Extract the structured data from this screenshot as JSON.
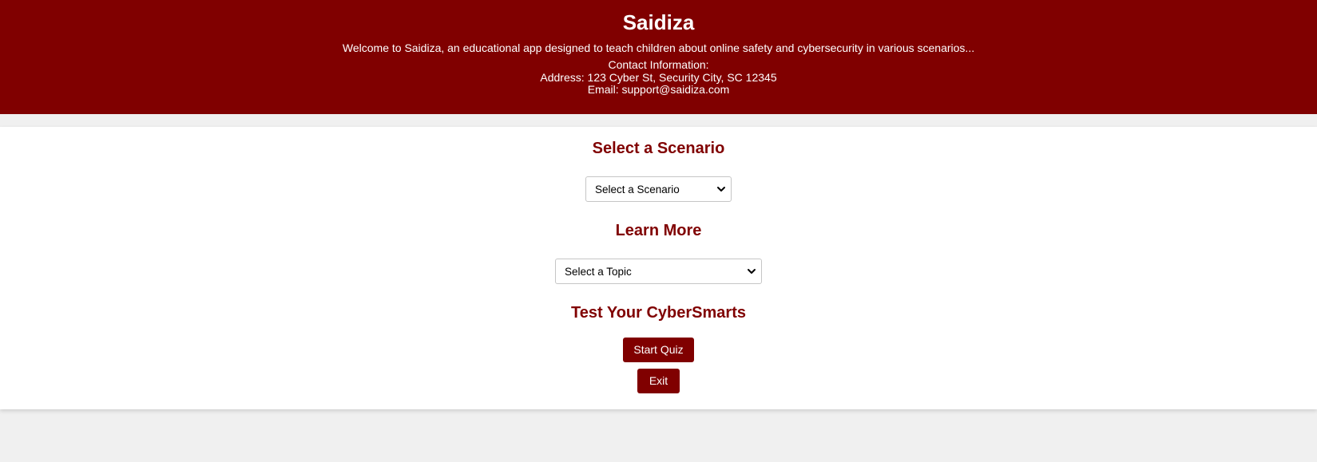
{
  "header": {
    "title": "Saidiza",
    "intro": "Welcome to Saidiza, an educational app designed to teach children about online safety and cybersecurity in various scenarios...",
    "contact_heading": "Contact Information:",
    "address": "Address: 123 Cyber St, Security City, SC 12345",
    "email": "Email: support@saidiza.com"
  },
  "scenario": {
    "title": "Select a Scenario",
    "select_value": "Select a Scenario"
  },
  "learn": {
    "title": "Learn More",
    "select_value": "Select a Topic"
  },
  "quiz": {
    "title": "Test Your CyberSmarts",
    "start_label": "Start Quiz",
    "exit_label": "Exit"
  },
  "colors": {
    "brand": "#800000",
    "background": "#f0f0f0",
    "panel": "#ffffff"
  },
  "icons": {
    "select_arrow": "chevron-down-icon"
  }
}
